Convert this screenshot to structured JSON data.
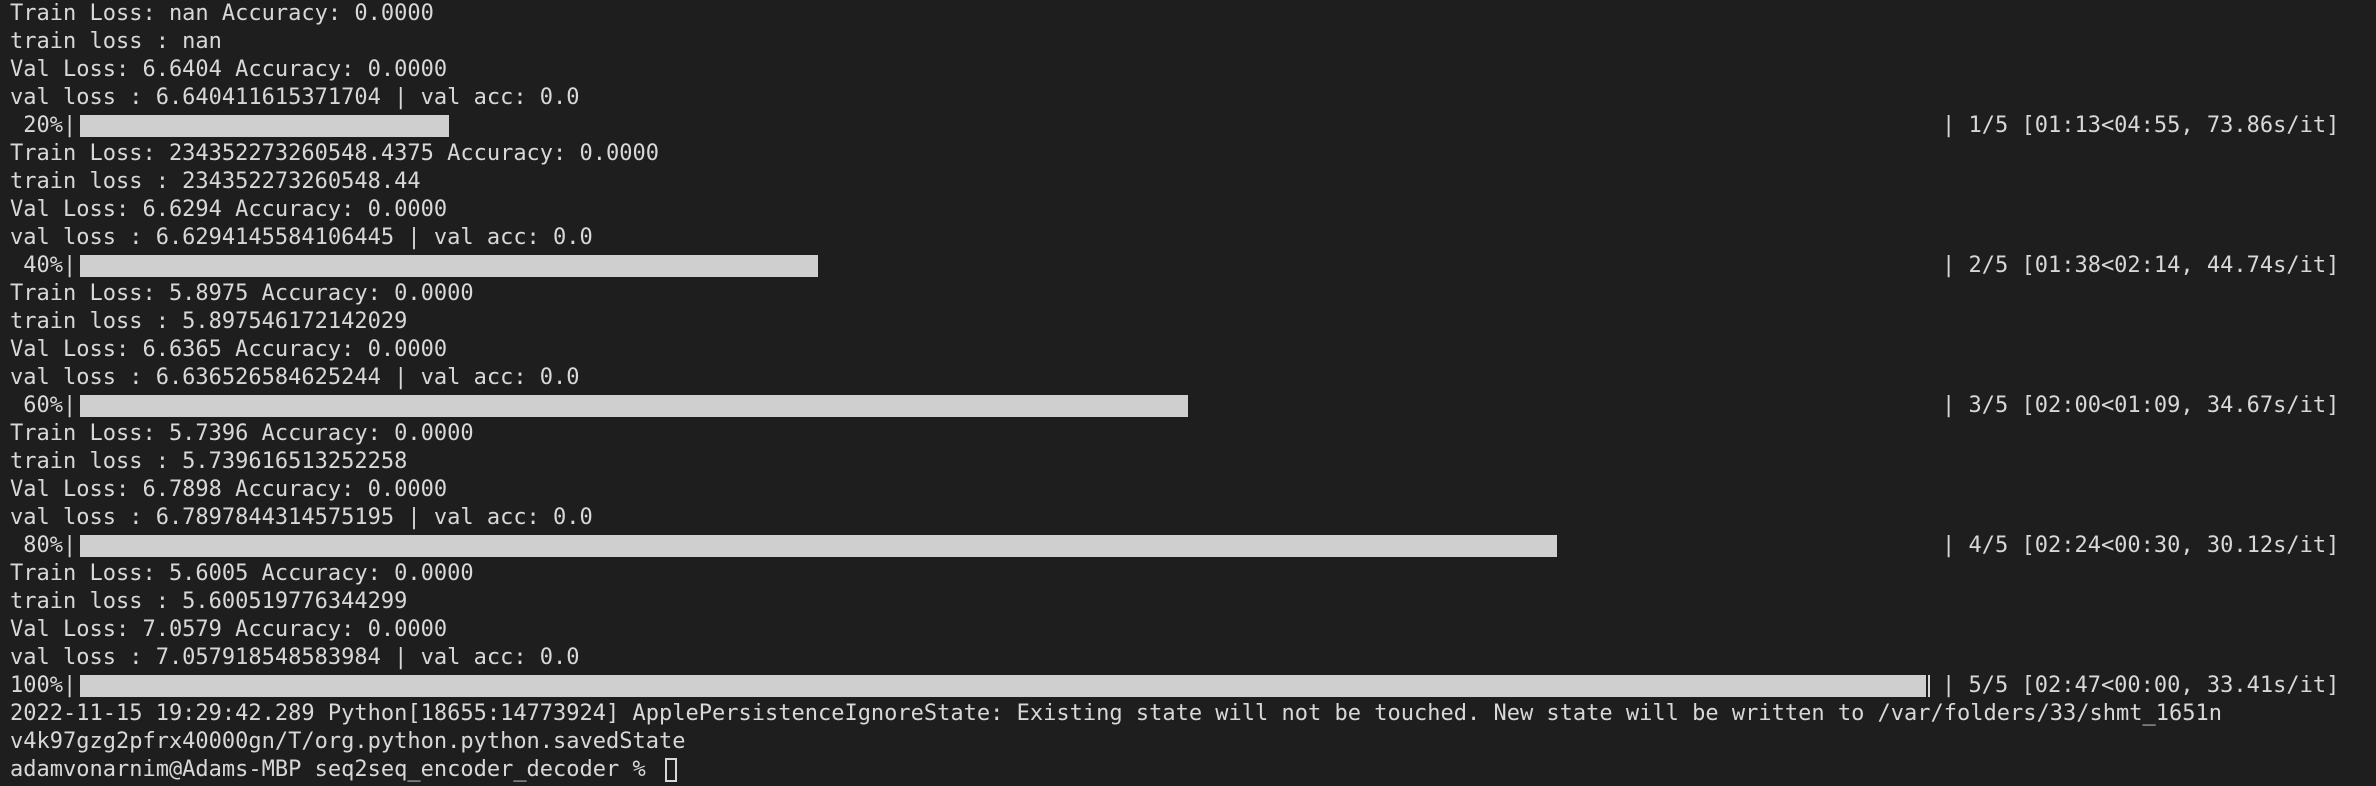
{
  "terminal": {
    "lines": [
      "Train Loss: nan Accuracy: 0.0000",
      "train loss : nan",
      "Val Loss: 6.6404 Accuracy: 0.0000",
      "val loss : 6.640411615371704 | val acc: 0.0",
      "Train Loss: 234352273260548.4375 Accuracy: 0.0000",
      "train loss : 234352273260548.44",
      "Val Loss: 6.6294 Accuracy: 0.0000",
      "val loss : 6.6294145584106445 | val acc: 0.0",
      "Train Loss: 5.8975 Accuracy: 0.0000",
      "train loss : 5.897546172142029",
      "Val Loss: 6.6365 Accuracy: 0.0000",
      "val loss : 6.636526584625244 | val acc: 0.0",
      "Train Loss: 5.7396 Accuracy: 0.0000",
      "train loss : 5.739616513252258",
      "Val Loss: 6.7898 Accuracy: 0.0000",
      "val loss : 6.7897844314575195 | val acc: 0.0",
      "Train Loss: 5.6005 Accuracy: 0.0000",
      "train loss : 5.600519776344299",
      "Val Loss: 7.0579 Accuracy: 0.0000",
      "val loss : 7.057918548583984 | val acc: 0.0",
      "2022-11-15 19:29:42.289 Python[18655:14773924] ApplePersistenceIgnoreState: Existing state will not be touched. New state will be written to /var/folders/33/shmt_1651n",
      "v4k97gzg2pfrx40000gn/T/org.python.python.savedState"
    ],
    "progress": [
      {
        "percent_label": " 20%|",
        "fraction": 0.2,
        "stats": "| 1/5 [01:13<04:55, 73.86s/it]"
      },
      {
        "percent_label": " 40%|",
        "fraction": 0.4,
        "stats": "| 2/5 [01:38<02:14, 44.74s/it]"
      },
      {
        "percent_label": " 60%|",
        "fraction": 0.6,
        "stats": "| 3/5 [02:00<01:09, 34.67s/it]"
      },
      {
        "percent_label": " 80%|",
        "fraction": 0.8,
        "stats": "| 4/5 [02:24<00:30, 30.12s/it]"
      },
      {
        "percent_label": "100%|",
        "fraction": 1.0,
        "stats": "| 5/5 [02:47<00:00, 33.41s/it]"
      }
    ],
    "prompt": "adamvonarnim@Adams-MBP seq2seq_encoder_decoder % ",
    "colors": {
      "background": "#1e1e1e",
      "text": "#d8d8d8",
      "bar_fill": "#cfcfcf"
    }
  }
}
